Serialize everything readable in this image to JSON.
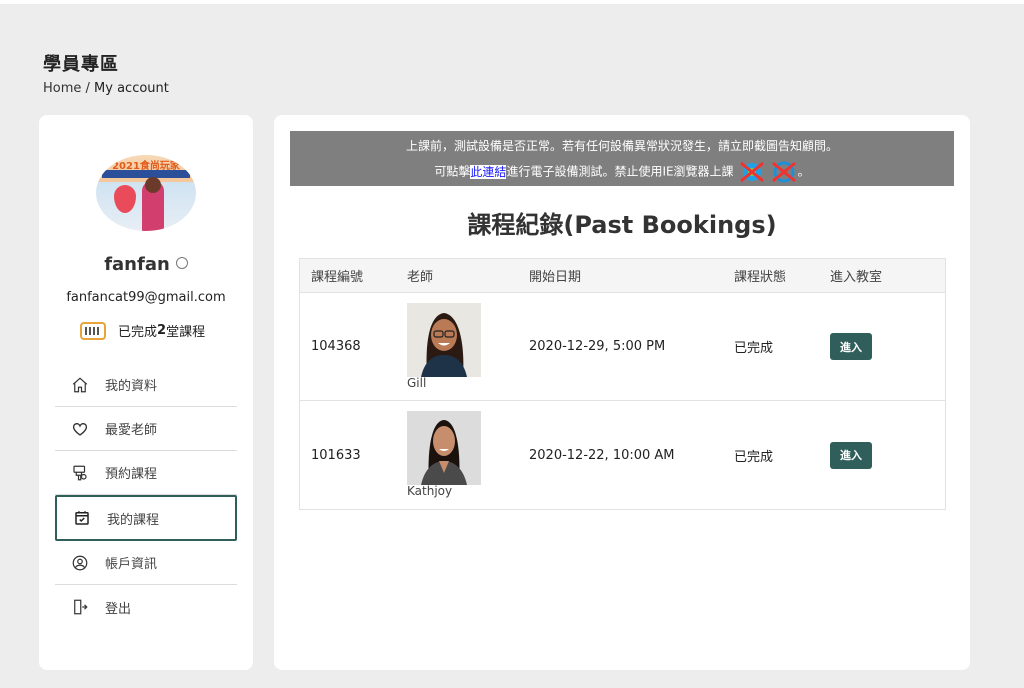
{
  "page": {
    "title": "學員專區",
    "breadcrumb": {
      "home": "Home",
      "separator": " / ",
      "current": "My account"
    }
  },
  "profile": {
    "avatar_banner": "2021食尚玩家",
    "username": "fanfan",
    "email": "fanfancat99@gmail.com",
    "completed_prefix": "已完成",
    "completed_count": "2",
    "completed_suffix": "堂課程"
  },
  "menu": {
    "items": [
      {
        "label": "我的資料",
        "icon": "home-icon"
      },
      {
        "label": "最愛老師",
        "icon": "heart-icon"
      },
      {
        "label": "預約課程",
        "icon": "booking-icon"
      },
      {
        "label": "我的課程",
        "icon": "calendar-check-icon",
        "active": true
      },
      {
        "label": "帳戶資訊",
        "icon": "user-circle-icon"
      },
      {
        "label": "登出",
        "icon": "logout-icon"
      }
    ]
  },
  "notice": {
    "line1": "上課前，測試設備是否正常。若有任何設備異常狀況發生，請立即截圖告知顧問。",
    "line2_prefix": "可點擊",
    "link_text": "此連結",
    "line2_middle": "進行電子設備測試。禁止使用IE瀏覽器上課",
    "line2_suffix": "。"
  },
  "bookings": {
    "title": "課程紀錄(Past Bookings)",
    "columns": [
      "課程編號",
      "老師",
      "開始日期",
      "課程狀態",
      "進入教室"
    ],
    "rows": [
      {
        "id": "104368",
        "teacher": "Gill",
        "date": "2020-12-29, 5:00 PM",
        "status": "已完成",
        "action": "進入"
      },
      {
        "id": "101633",
        "teacher": "Kathjoy",
        "date": "2020-12-22, 10:00 AM",
        "status": "已完成",
        "action": "進入"
      }
    ]
  },
  "colors": {
    "accent": "#2f5e5b",
    "notice_bg": "#7f7f7f",
    "page_bg": "#ededed"
  }
}
